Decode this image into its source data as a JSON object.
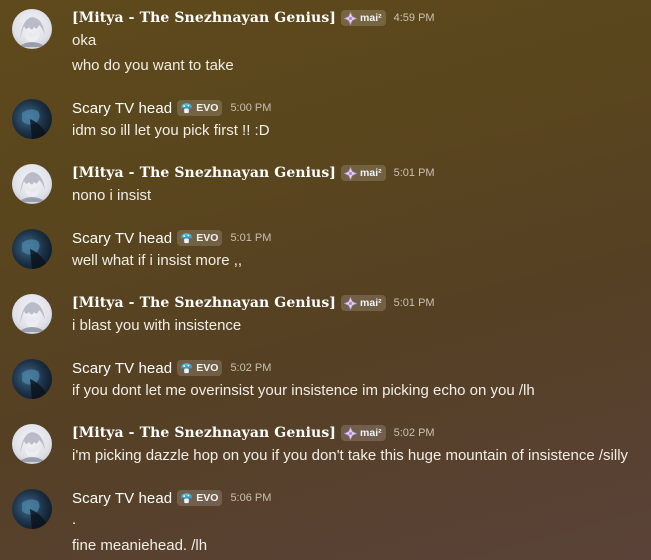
{
  "colors": {
    "username": "#ffffff",
    "message_text": "#f1eee6",
    "timestamp": "#c9c0b0",
    "tag_background": "rgba(255,255,255,0.16)"
  },
  "messages": [
    {
      "author": "[Mitya - The Snezhnayan Genius]",
      "tag": "mai²",
      "tag_icon": "sparkle-diamond-icon",
      "time": "4:59 PM",
      "lines": [
        "oka",
        "who do you want to take"
      ]
    },
    {
      "author": "Scary TV head",
      "tag": "EVO",
      "tag_icon": "mushroom-icon",
      "time": "5:00 PM",
      "lines": [
        "idm so ill let you pick first !! :D"
      ]
    },
    {
      "author": "[Mitya - The Snezhnayan Genius]",
      "tag": "mai²",
      "tag_icon": "sparkle-diamond-icon",
      "time": "5:01 PM",
      "lines": [
        "nono i insist"
      ]
    },
    {
      "author": "Scary TV head",
      "tag": "EVO",
      "tag_icon": "mushroom-icon",
      "time": "5:01 PM",
      "lines": [
        "well what if i insist more ,,"
      ]
    },
    {
      "author": "[Mitya - The Snezhnayan Genius]",
      "tag": "mai²",
      "tag_icon": "sparkle-diamond-icon",
      "time": "5:01 PM",
      "lines": [
        "i blast you with insistence"
      ]
    },
    {
      "author": "Scary TV head",
      "tag": "EVO",
      "tag_icon": "mushroom-icon",
      "time": "5:02 PM",
      "lines": [
        "if you dont let me overinsist your insistence im picking echo on you /lh"
      ]
    },
    {
      "author": "[Mitya - The Snezhnayan Genius]",
      "tag": "mai²",
      "tag_icon": "sparkle-diamond-icon",
      "time": "5:02 PM",
      "lines": [
        "i'm picking dazzle hop on you if you don't take this huge mountain of insistence /silly"
      ]
    },
    {
      "author": "Scary TV head",
      "tag": "EVO",
      "tag_icon": "mushroom-icon",
      "time": "5:06 PM",
      "lines": [
        ".",
        "fine meaniehead. /lh"
      ]
    }
  ]
}
